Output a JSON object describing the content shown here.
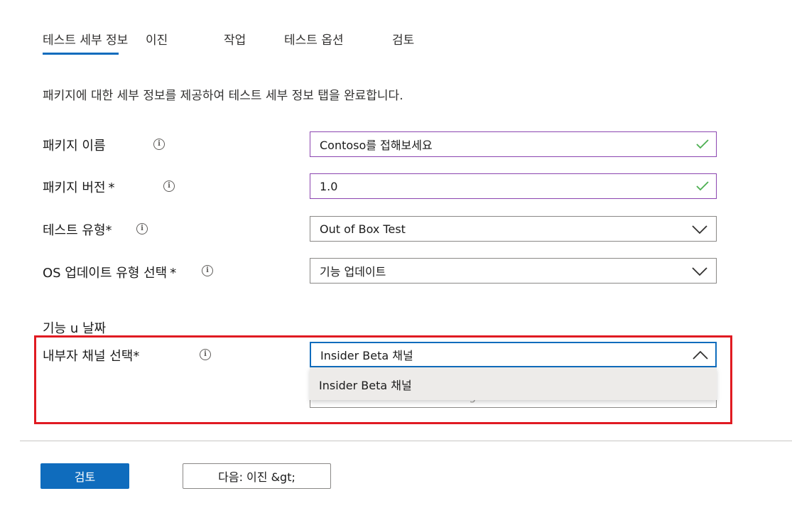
{
  "tabs": [
    {
      "label": "테스트 세부 정보",
      "active": true
    },
    {
      "label": "이진",
      "active": false
    },
    {
      "label": "작업",
      "active": false
    },
    {
      "label": "테스트 옵션",
      "active": false
    },
    {
      "label": "검토",
      "active": false
    }
  ],
  "intro": "패키지에 대한 세부 정보를 제공하여 테스트 세부 정보 탭을 완료합니다.",
  "form": {
    "package_name": {
      "label": "패키지 이름",
      "value": "Contoso를 접해보세요"
    },
    "package_version": {
      "label": "패키지 버전",
      "required_mark": "*",
      "value": "1.0"
    },
    "test_type": {
      "label": "테스트 유형*",
      "value": "Out of Box Test"
    },
    "os_update_type": {
      "label": "OS 업데이트 유형 선택",
      "required_mark": "*",
      "value": "기능 업데이트"
    },
    "feature_section_label": "기능 u 날짜",
    "insider_channel": {
      "label": "내부자 채널 선택*",
      "value": "Insider Beta 채널",
      "options": [
        "Insider Beta 채널"
      ],
      "hidden_placeholder": "Select OS baseline for Insight"
    }
  },
  "buttons": {
    "review": "검토",
    "next": "다음: 이진 &gt;"
  },
  "colors": {
    "accent": "#0f6cbd",
    "valid_border": "#8b45b0",
    "check": "#4caf50",
    "highlight": "#e01b22"
  },
  "icons": {
    "info": "info-icon",
    "check": "check-icon",
    "chevron_down": "chevron-down-icon",
    "chevron_up": "chevron-up-icon"
  }
}
